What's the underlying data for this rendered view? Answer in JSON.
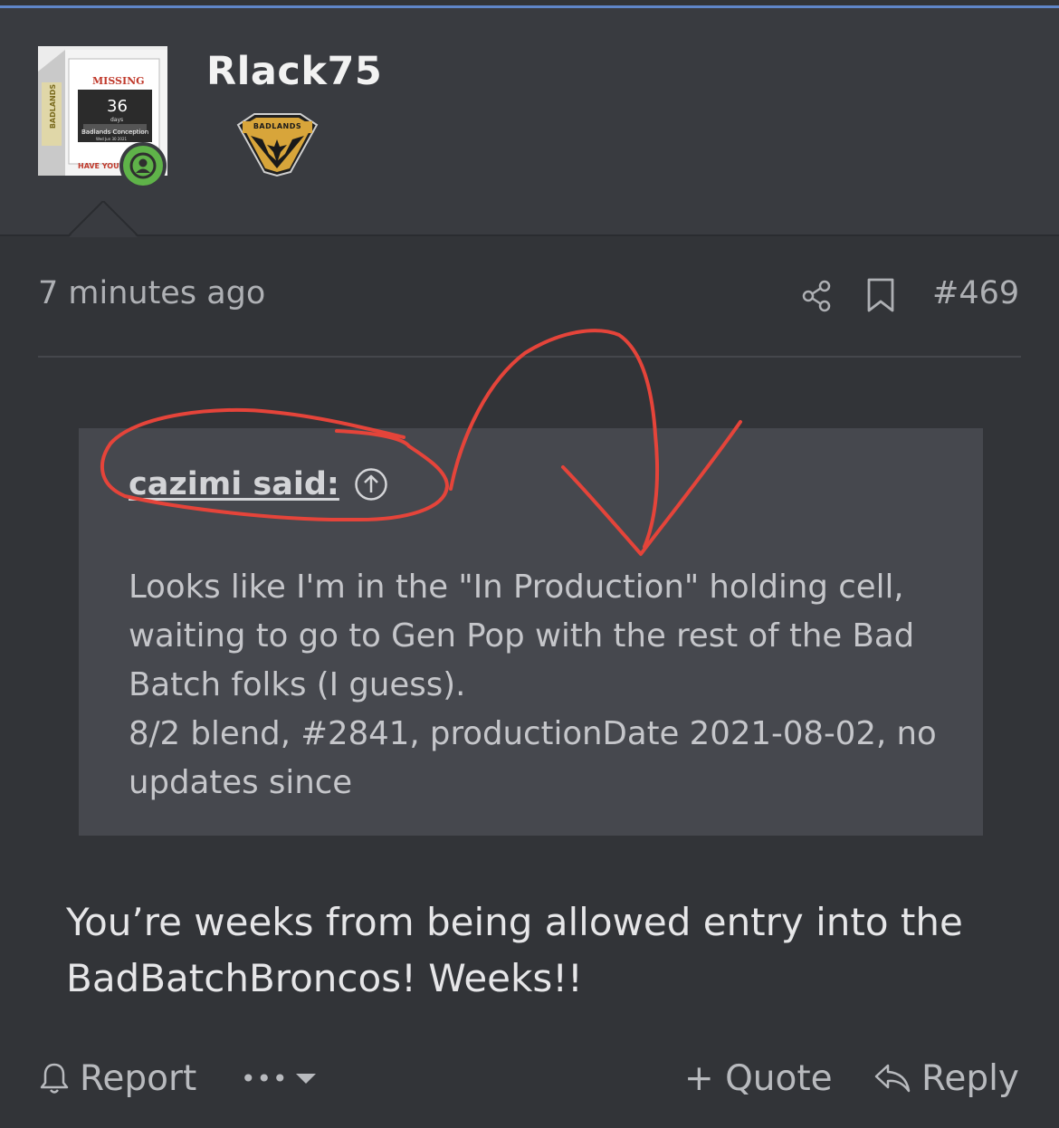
{
  "accent_color": "#5f86c9",
  "annotation_color": "#e5443a",
  "user": {
    "username": "Rlack75",
    "avatar": {
      "missing": "MISSING",
      "days_number": "36",
      "days_label": "days",
      "caption": "Badlands Conception",
      "date": "Wed Jun 30 2021",
      "have_you": "HAVE YOU",
      "side_text": "BADLANDS"
    },
    "online": true,
    "badge": {
      "name": "BADLANDS"
    }
  },
  "post": {
    "time": "7 minutes ago",
    "number": "#469",
    "quote": {
      "author": "cazimi said:",
      "lines": [
        "Looks like I'm in the \"In Production\" holding cell,",
        "waiting to go to Gen Pop with the rest of the Bad",
        "Batch folks (I guess).",
        "8/2 blend, #2841, productionDate 2021-08-02, no",
        "updates since"
      ]
    },
    "body_lines": [
      "You’re weeks from being allowed entry into the",
      "BadBatchBroncos! Weeks!!"
    ]
  },
  "actions": {
    "report": "Report",
    "more": "•••",
    "quote": "+ Quote",
    "reply": "Reply"
  }
}
